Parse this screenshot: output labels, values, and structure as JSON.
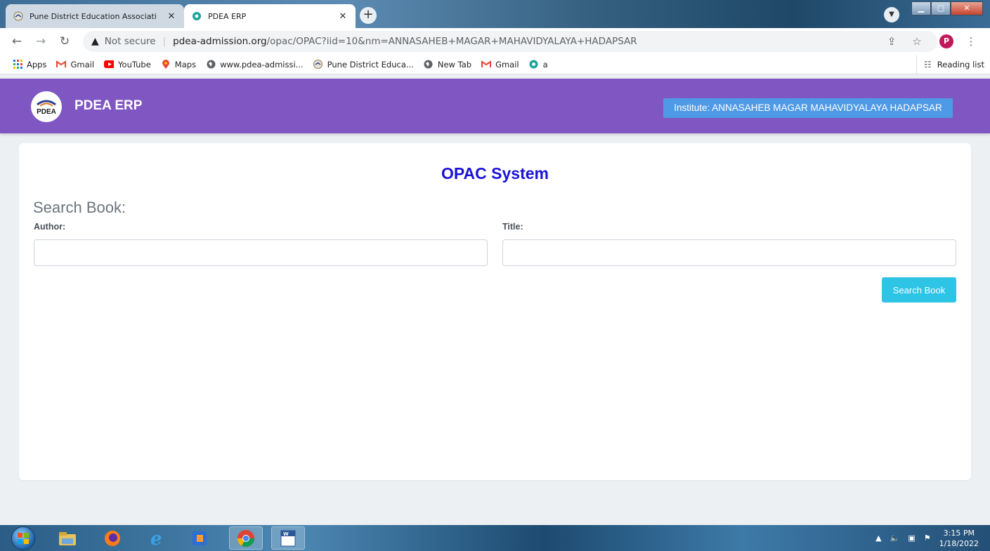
{
  "browser": {
    "tabs": [
      {
        "title": "Pune District Education Associati",
        "active": false
      },
      {
        "title": "PDEA ERP",
        "active": true
      }
    ],
    "new_tab": "+",
    "address": {
      "security": "Not secure",
      "host": "pdea-admission.org",
      "path": "/opac/OPAC?iid=10&nm=ANNASAHEB+MAGAR+MAHAVIDYALAYA+HADAPSAR"
    },
    "profile_initial": "P",
    "bookmarks": [
      {
        "label": "Apps",
        "icon": "apps-grid-icon"
      },
      {
        "label": "Gmail",
        "icon": "gmail-icon"
      },
      {
        "label": "YouTube",
        "icon": "youtube-icon"
      },
      {
        "label": "Maps",
        "icon": "maps-icon"
      },
      {
        "label": "www.pdea-admissi...",
        "icon": "globe-icon"
      },
      {
        "label": "Pune District Educa...",
        "icon": "pdea-icon"
      },
      {
        "label": "New Tab",
        "icon": "globe-icon"
      },
      {
        "label": "Gmail",
        "icon": "gmail-icon"
      },
      {
        "label": "a",
        "icon": "site-icon"
      }
    ],
    "reading_list": "Reading list"
  },
  "header": {
    "logo_text": "PDEA",
    "brand": "PDEA ERP",
    "institute": "Institute: ANNASAHEB MAGAR MAHAVIDYALAYA HADAPSAR"
  },
  "main": {
    "title": "OPAC System",
    "search_heading": "Search Book:",
    "author_label": "Author:",
    "author_value": "",
    "title_label": "Title:",
    "title_value": "",
    "search_button": "Search Book"
  },
  "taskbar": {
    "time": "3:15 PM",
    "date": "1/18/2022"
  },
  "colors": {
    "header_bg": "#7f56c2",
    "institute_bg": "#4f9ae6",
    "title_color": "#1a12d6",
    "button_bg": "#2ec4e6"
  }
}
